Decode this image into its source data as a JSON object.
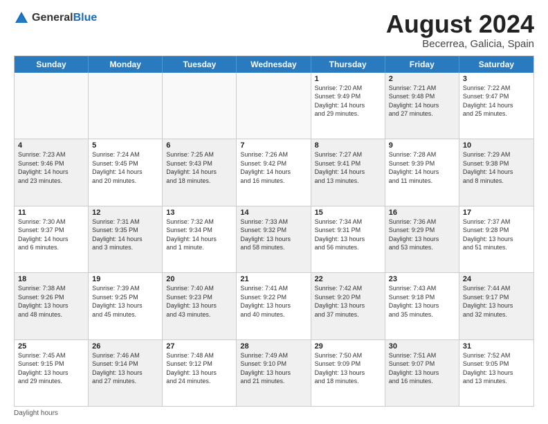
{
  "header": {
    "logo_general": "General",
    "logo_blue": "Blue",
    "month_year": "August 2024",
    "location": "Becerrea, Galicia, Spain"
  },
  "weekdays": [
    "Sunday",
    "Monday",
    "Tuesday",
    "Wednesday",
    "Thursday",
    "Friday",
    "Saturday"
  ],
  "footer": {
    "note": "Daylight hours"
  },
  "rows": [
    [
      {
        "day": "",
        "text": "",
        "shaded": true
      },
      {
        "day": "",
        "text": "",
        "shaded": true
      },
      {
        "day": "",
        "text": "",
        "shaded": false
      },
      {
        "day": "",
        "text": "",
        "shaded": true
      },
      {
        "day": "1",
        "text": "Sunrise: 7:20 AM\nSunset: 9:49 PM\nDaylight: 14 hours\nand 29 minutes.",
        "shaded": false
      },
      {
        "day": "2",
        "text": "Sunrise: 7:21 AM\nSunset: 9:48 PM\nDaylight: 14 hours\nand 27 minutes.",
        "shaded": true
      },
      {
        "day": "3",
        "text": "Sunrise: 7:22 AM\nSunset: 9:47 PM\nDaylight: 14 hours\nand 25 minutes.",
        "shaded": false
      }
    ],
    [
      {
        "day": "4",
        "text": "Sunrise: 7:23 AM\nSunset: 9:46 PM\nDaylight: 14 hours\nand 23 minutes.",
        "shaded": true
      },
      {
        "day": "5",
        "text": "Sunrise: 7:24 AM\nSunset: 9:45 PM\nDaylight: 14 hours\nand 20 minutes.",
        "shaded": false
      },
      {
        "day": "6",
        "text": "Sunrise: 7:25 AM\nSunset: 9:43 PM\nDaylight: 14 hours\nand 18 minutes.",
        "shaded": true
      },
      {
        "day": "7",
        "text": "Sunrise: 7:26 AM\nSunset: 9:42 PM\nDaylight: 14 hours\nand 16 minutes.",
        "shaded": false
      },
      {
        "day": "8",
        "text": "Sunrise: 7:27 AM\nSunset: 9:41 PM\nDaylight: 14 hours\nand 13 minutes.",
        "shaded": true
      },
      {
        "day": "9",
        "text": "Sunrise: 7:28 AM\nSunset: 9:39 PM\nDaylight: 14 hours\nand 11 minutes.",
        "shaded": false
      },
      {
        "day": "10",
        "text": "Sunrise: 7:29 AM\nSunset: 9:38 PM\nDaylight: 14 hours\nand 8 minutes.",
        "shaded": true
      }
    ],
    [
      {
        "day": "11",
        "text": "Sunrise: 7:30 AM\nSunset: 9:37 PM\nDaylight: 14 hours\nand 6 minutes.",
        "shaded": false
      },
      {
        "day": "12",
        "text": "Sunrise: 7:31 AM\nSunset: 9:35 PM\nDaylight: 14 hours\nand 3 minutes.",
        "shaded": true
      },
      {
        "day": "13",
        "text": "Sunrise: 7:32 AM\nSunset: 9:34 PM\nDaylight: 14 hours\nand 1 minute.",
        "shaded": false
      },
      {
        "day": "14",
        "text": "Sunrise: 7:33 AM\nSunset: 9:32 PM\nDaylight: 13 hours\nand 58 minutes.",
        "shaded": true
      },
      {
        "day": "15",
        "text": "Sunrise: 7:34 AM\nSunset: 9:31 PM\nDaylight: 13 hours\nand 56 minutes.",
        "shaded": false
      },
      {
        "day": "16",
        "text": "Sunrise: 7:36 AM\nSunset: 9:29 PM\nDaylight: 13 hours\nand 53 minutes.",
        "shaded": true
      },
      {
        "day": "17",
        "text": "Sunrise: 7:37 AM\nSunset: 9:28 PM\nDaylight: 13 hours\nand 51 minutes.",
        "shaded": false
      }
    ],
    [
      {
        "day": "18",
        "text": "Sunrise: 7:38 AM\nSunset: 9:26 PM\nDaylight: 13 hours\nand 48 minutes.",
        "shaded": true
      },
      {
        "day": "19",
        "text": "Sunrise: 7:39 AM\nSunset: 9:25 PM\nDaylight: 13 hours\nand 45 minutes.",
        "shaded": false
      },
      {
        "day": "20",
        "text": "Sunrise: 7:40 AM\nSunset: 9:23 PM\nDaylight: 13 hours\nand 43 minutes.",
        "shaded": true
      },
      {
        "day": "21",
        "text": "Sunrise: 7:41 AM\nSunset: 9:22 PM\nDaylight: 13 hours\nand 40 minutes.",
        "shaded": false
      },
      {
        "day": "22",
        "text": "Sunrise: 7:42 AM\nSunset: 9:20 PM\nDaylight: 13 hours\nand 37 minutes.",
        "shaded": true
      },
      {
        "day": "23",
        "text": "Sunrise: 7:43 AM\nSunset: 9:18 PM\nDaylight: 13 hours\nand 35 minutes.",
        "shaded": false
      },
      {
        "day": "24",
        "text": "Sunrise: 7:44 AM\nSunset: 9:17 PM\nDaylight: 13 hours\nand 32 minutes.",
        "shaded": true
      }
    ],
    [
      {
        "day": "25",
        "text": "Sunrise: 7:45 AM\nSunset: 9:15 PM\nDaylight: 13 hours\nand 29 minutes.",
        "shaded": false
      },
      {
        "day": "26",
        "text": "Sunrise: 7:46 AM\nSunset: 9:14 PM\nDaylight: 13 hours\nand 27 minutes.",
        "shaded": true
      },
      {
        "day": "27",
        "text": "Sunrise: 7:48 AM\nSunset: 9:12 PM\nDaylight: 13 hours\nand 24 minutes.",
        "shaded": false
      },
      {
        "day": "28",
        "text": "Sunrise: 7:49 AM\nSunset: 9:10 PM\nDaylight: 13 hours\nand 21 minutes.",
        "shaded": true
      },
      {
        "day": "29",
        "text": "Sunrise: 7:50 AM\nSunset: 9:09 PM\nDaylight: 13 hours\nand 18 minutes.",
        "shaded": false
      },
      {
        "day": "30",
        "text": "Sunrise: 7:51 AM\nSunset: 9:07 PM\nDaylight: 13 hours\nand 16 minutes.",
        "shaded": true
      },
      {
        "day": "31",
        "text": "Sunrise: 7:52 AM\nSunset: 9:05 PM\nDaylight: 13 hours\nand 13 minutes.",
        "shaded": false
      }
    ]
  ]
}
